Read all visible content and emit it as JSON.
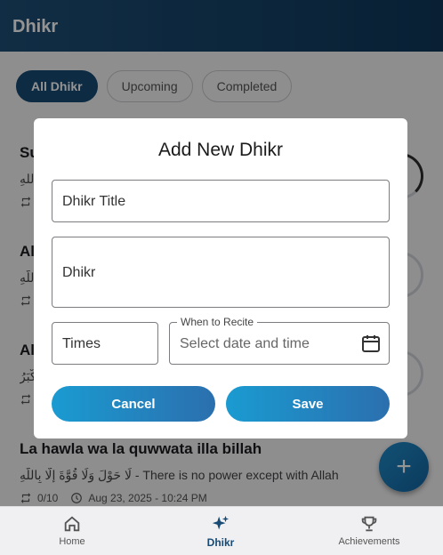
{
  "appbar": {
    "title": "Dhikr"
  },
  "filters": {
    "all": "All Dhikr",
    "upcoming": "Upcoming",
    "completed": "Completed"
  },
  "list": {
    "items": [
      {
        "title": "Su",
        "arabic": "للهِ",
        "count": ""
      },
      {
        "title": "Al",
        "arabic": "للَّهِ",
        "count": ""
      },
      {
        "title": "Al",
        "arabic": "كْبَرُ",
        "count": ""
      },
      {
        "title": "La hawla wa la quwwata illa billah",
        "subtitle": "لَا حَوْلَ وَلَا قُوَّةَ إِلَّا بِاللَّهِ - There is no power except with Allah",
        "count": "0/10",
        "datetime": "Aug 23, 2025 - 10:24 PM"
      }
    ]
  },
  "nav": {
    "home": "Home",
    "dhikr": "Dhikr",
    "achievements": "Achievements"
  },
  "dialog": {
    "title": "Add New Dhikr",
    "title_field": "Dhikr Title",
    "dhikr_field": "Dhikr",
    "times_field": "Times",
    "when_label": "When to Recite",
    "when_placeholder": "Select date and time",
    "cancel": "Cancel",
    "save": "Save"
  },
  "colors": {
    "accent": "#174a74",
    "appbar": "#1d4f77",
    "button": "#1a9bd1"
  }
}
